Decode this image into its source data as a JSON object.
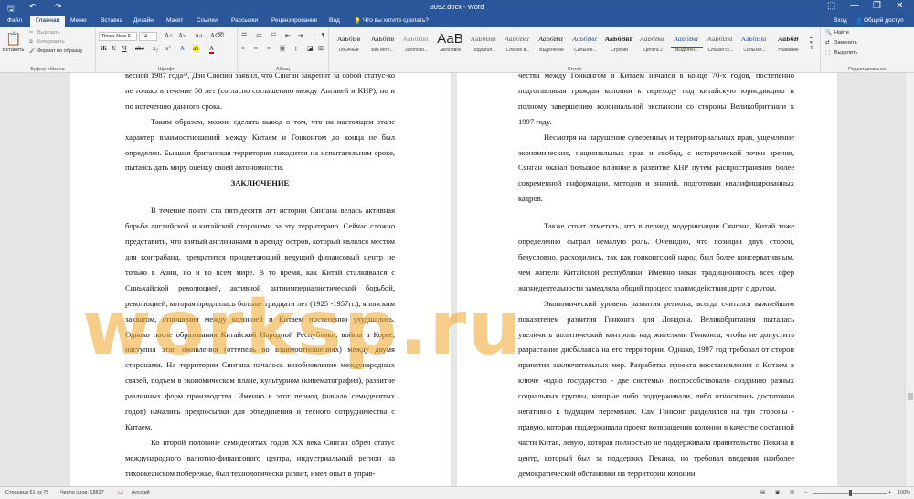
{
  "titlebar": {
    "title": "3092.docx - Word",
    "save_icon": "save-icon",
    "undo_icon": "undo-icon",
    "redo_icon": "redo-icon",
    "minimize": "—",
    "restore": "❐",
    "close": "✕",
    "ribbon_display": "⬚"
  },
  "tabs": [
    "Файл",
    "Главная",
    "Меню",
    "Вставка",
    "Дизайн",
    "Макет",
    "Ссылки",
    "Рассылки",
    "Рецензирование",
    "Вид"
  ],
  "tell_me": "Что вы хотите сделать?",
  "signin": "Вход",
  "share": "Общий доступ",
  "clipboard": {
    "paste": "Вставить",
    "cut": "Вырезать",
    "copy": "Копировать",
    "format_painter": "Формат по образцу",
    "label": "Буфер обмена"
  },
  "font": {
    "name": "Times New F",
    "size": "14",
    "label": "Шрифт"
  },
  "paragraph": {
    "label": "Абзац"
  },
  "styles": {
    "label": "Стили",
    "items": [
      {
        "sample": "АаБбВв",
        "name": "Обычный"
      },
      {
        "sample": "АаБбВв",
        "name": "Без инте..."
      },
      {
        "sample": "АаБбВвГ",
        "name": "Заголово..."
      },
      {
        "sample": "АаВ",
        "name": "Заголовок"
      },
      {
        "sample": "АаБбВвГ",
        "name": "Подзагол..."
      },
      {
        "sample": "АаБбВвГ",
        "name": "Слабое в..."
      },
      {
        "sample": "АаБбВвГ",
        "name": "Выделение"
      },
      {
        "sample": "АаБбВвГ",
        "name": "Сильное..."
      },
      {
        "sample": "АаБбВвГ",
        "name": "Строгий"
      },
      {
        "sample": "АаБбВвГ",
        "name": "Цитата 2"
      },
      {
        "sample": "АаБбВвГ",
        "name": "Выделен..."
      },
      {
        "sample": "АаБбВвГ",
        "name": "Слабая сс..."
      },
      {
        "sample": "АаБбВвГ",
        "name": "Сильная..."
      },
      {
        "sample": "АаБбВ",
        "name": "Название"
      }
    ]
  },
  "editing": {
    "find": "Найти",
    "replace": "Заменить",
    "select": "Выделить",
    "label": "Редактирование"
  },
  "page1": {
    "paragraphs": [
      {
        "cls": "noind",
        "text": "весной 1987 года²³, Дэн Сяопин заявил, что Сянган закрепит за собой статус-ко не только в течение 50 лет (согласно соглашению между Англией и КНР), но и по истечению данного срока."
      },
      {
        "cls": "",
        "text": "Таким образом, можно сделать вывод о том, что на настоящем этапе характер взаимоотношений между Китаем и Гонконгом до конца не был определен. Бывшая британская территория находится на испытательном сроке, пытаясь дать миру оценку своей автономности."
      },
      {
        "cls": "head",
        "text": "ЗАКЛЮЧЕНИЕ"
      },
      {
        "cls": "gap",
        "text": ""
      },
      {
        "cls": "",
        "text": "В течение почти ста пятидесяти лет истории Сянгана велась активная борьба английской и китайской сторонами за эту территорию. Сейчас сложно представить, что взятый англичанами в аренду остров, который являлся местом для контрабанд, превратится процветающий ведущий финансовый центр не только в Азии, но и во всем мире. В то время, как Китай сталкивался с Синьхайской революцией, активной антиимпериалистической борьбой, революцией, которая продлилась больше тридцати лет (1925 -1957гг.), японским захватом, отношения между колонией и Китаем постепенно ухудшались. Однако после образования Китайской Народной Республики, войны в Корее, наступил этап оживления (оттепель во взаимоотношениях) между двумя сторонами. На территории Сянгана началось возобновление международных связей, подъем в экономическом плане, культурном (кинематография), развитие различных форм производства. Именно в этот период (начало семидесятых годов) начались предпосылки для объединения и тесного сотрудничества с Китаем."
      },
      {
        "cls": "",
        "text": "Ко второй половине семидесятых годов XX века Сянган обрел статус международного валютно-финансового центра, индустриальный регион на тихоокеанском побережье, был технологически развит, имел опыт в управ-"
      }
    ]
  },
  "page2": {
    "paragraphs": [
      {
        "cls": "noind",
        "text": "чества между Гонконгом и Китаем начался в конце 70-х годов, постепенно подготавливая граждан колонии к переходу под китайскую юрисдикцию и полному завершению колониальной экспансии со стороны Великобритании к 1997 году."
      },
      {
        "cls": "",
        "text": "Несмотря на нарушение суверенных и территориальных прав, ущемление экономических, национальных прав и свобод, с исторической точки зрения, Сянган оказал большое влияние в развитие КНР путем распространения более современной информации, методов и знаний, подготовки квалифицированных кадров."
      },
      {
        "cls": "gap",
        "text": ""
      },
      {
        "cls": "",
        "text": "Также стоит отметить, что в период модернизации Сянгана, Китай тоже определенно сыграл немалую роль. Очевидно, что позиции двух сторон, безусловно, расходились, так как гонконгский народ был более консервативным, чем жители Китайской республики. Именно некая традиционность всех сфер жизнедеятельности замедляла общий процесс взаимодействия друг с другом."
      },
      {
        "cls": "",
        "text": "Экономический уровень развития региона, всегда считался важнейшим показателем развития Гонконга для Лондона. Великобритания пыталась увеличить политический контроль над жителями Гонконга, чтобы не допустить разрастание дисбаланса на его территории. Однако, 1997 год требовал от сторон принятия заключительных мер. Разработка проекта восстановления с Китаем в ключе «одно государство - две системы» поспособствовало созданию разных социальных группы, которые либо поддерживали, либо относились достаточно негативно к будущим переменам. Сам Гонконг разделился на три стороны - правую, которая поддерживала проект возвращения колонии в качестве составной части Китая, левую, которая полностью не поддерживала правительство Пекина и центр, который был за поддержку Пекина, но требовал введения наиболее демократической обстановки на территории колонии"
      }
    ]
  },
  "watermark": "worksp.ru",
  "status": {
    "page": "Страница 61 из 75",
    "words": "Число слов: 18827",
    "lang": "русский",
    "zoom": "100%"
  }
}
